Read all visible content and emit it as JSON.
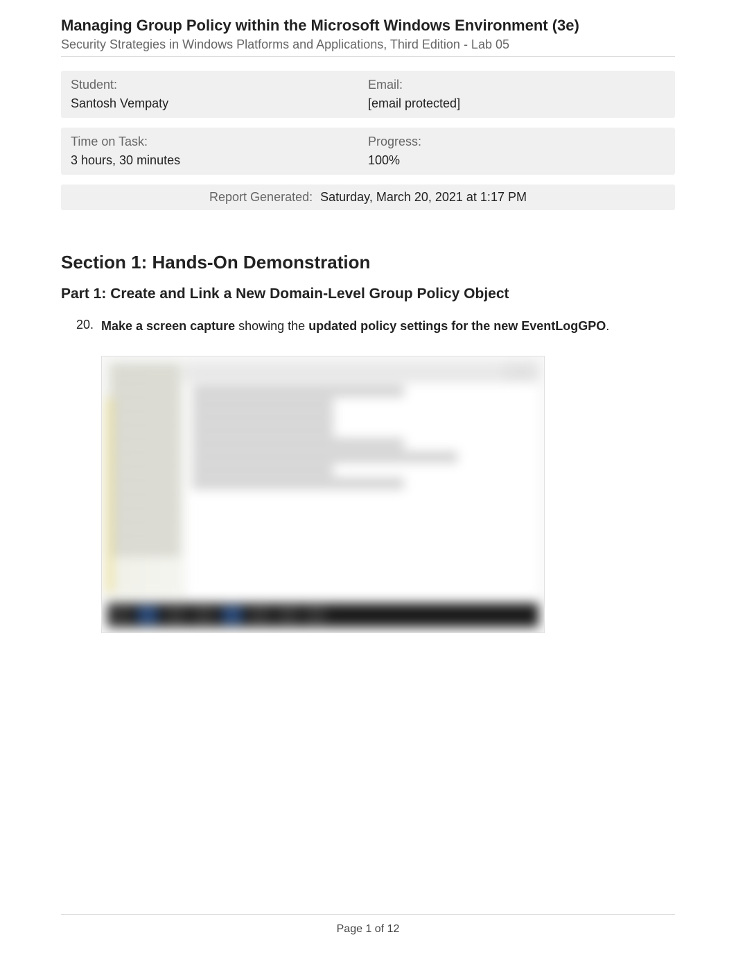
{
  "header": {
    "title": "Managing Group Policy within the Microsoft Windows Environment (3e)",
    "subtitle": "Security Strategies in Windows Platforms and Applications, Third Edition - Lab 05"
  },
  "info": {
    "student_label": "Student:",
    "student_value": "Santosh Vempaty",
    "email_label": "Email:",
    "email_value": "[email protected]",
    "time_label": "Time on Task:",
    "time_value": "3 hours, 30 minutes",
    "progress_label": "Progress:",
    "progress_value": "100%"
  },
  "report": {
    "label": "Report Generated:",
    "value": "Saturday, March 20, 2021 at 1:17 PM"
  },
  "section": {
    "title": "Section 1: Hands-On Demonstration",
    "part_title": "Part 1: Create and Link a New Domain-Level Group Policy Object"
  },
  "instruction": {
    "number": "20.",
    "bold1": "Make a screen capture",
    "mid": " showing the ",
    "bold2": "updated policy settings for the new EventLogGPO",
    "end": "."
  },
  "footer": {
    "page_text": "Page 1 of 12"
  }
}
